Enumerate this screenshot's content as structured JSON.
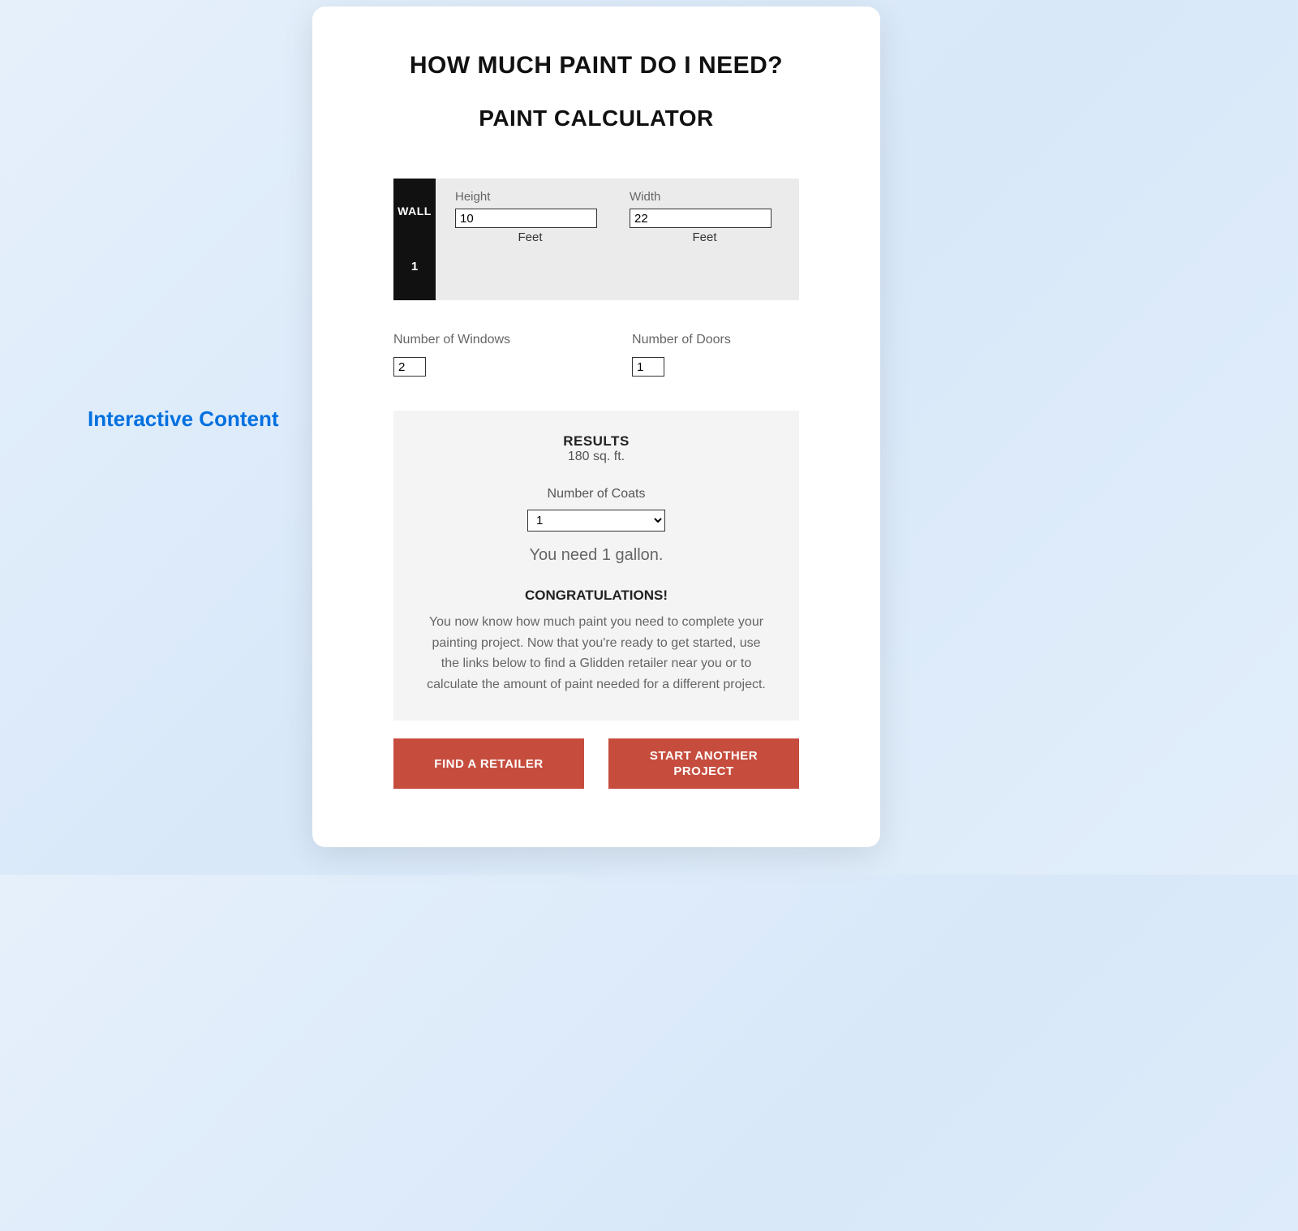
{
  "sidebar": {
    "label": "Interactive Content"
  },
  "heading": {
    "main": "HOW MUCH PAINT DO I NEED?",
    "sub": "PAINT CALCULATOR"
  },
  "wall": {
    "tab_label": "WALL",
    "tab_number": "1",
    "height_label": "Height",
    "height_value": "10",
    "height_unit": "Feet",
    "width_label": "Width",
    "width_value": "22",
    "width_unit": "Feet"
  },
  "counts": {
    "windows_label": "Number of Windows",
    "windows_value": "2",
    "doors_label": "Number of Doors",
    "doors_value": "1"
  },
  "results": {
    "title": "RESULTS",
    "sqft": "180 sq. ft.",
    "coats_label": "Number of Coats",
    "coats_value": "1",
    "gallons": "You need 1 gallon.",
    "congrats_title": "CONGRATULATIONS!",
    "congrats_text": "You now know how much paint you need to complete your painting project. Now that you're ready to get started, use the links below to find a Glidden retailer near you or to calculate the amount of paint needed for a different project."
  },
  "buttons": {
    "find_retailer": "FIND A RETAILER",
    "start_another": "START ANOTHER PROJECT"
  }
}
